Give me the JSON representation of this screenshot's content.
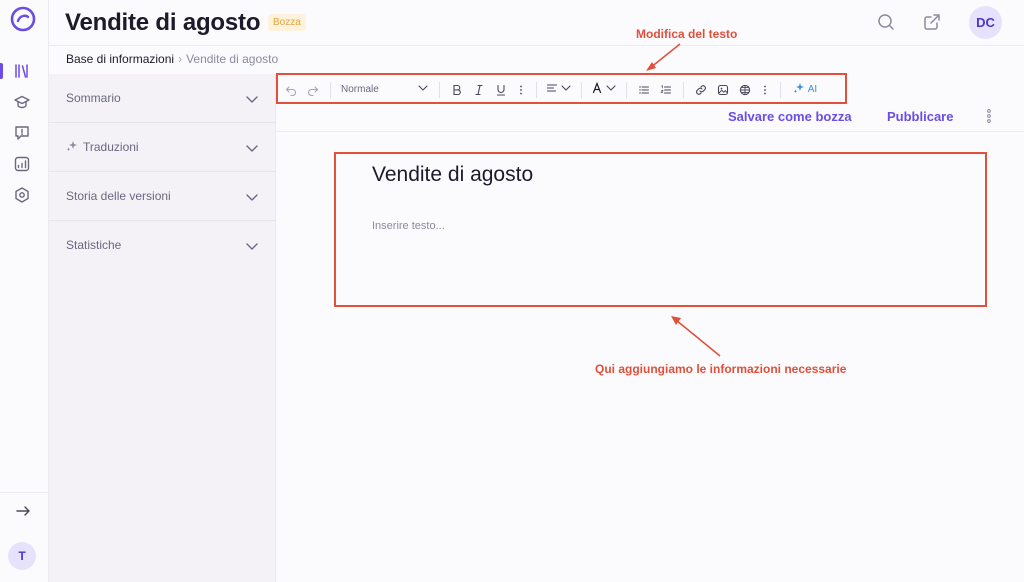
{
  "header": {
    "title": "Vendite di agosto",
    "status": "Bozza",
    "avatar_initials": "DC"
  },
  "breadcrumb": {
    "root": "Base di informazioni",
    "current": "Vendite di agosto"
  },
  "rail": {
    "items": [
      "library-icon",
      "graduation-cap-icon",
      "message-alert-icon",
      "analytics-icon",
      "settings-hexagon-icon"
    ],
    "user_initial": "T"
  },
  "sidebar": {
    "items": [
      {
        "label": "Sommario"
      },
      {
        "label": "Traduzioni"
      },
      {
        "label": "Storia delle versioni"
      },
      {
        "label": "Statistiche"
      }
    ]
  },
  "toolbar": {
    "format_value": "Normale",
    "ai_label": "AI"
  },
  "actions": {
    "save_draft": "Salvare come bozza",
    "publish": "Pubblicare"
  },
  "editor": {
    "title": "Vendite di agosto",
    "placeholder": "Inserire testo..."
  },
  "annotations": {
    "toolbar_note": "Modifica del testo",
    "editor_note": "Qui aggiungiamo le informazioni necessarie"
  },
  "colors": {
    "accent": "#6b4de6",
    "annotation": "#e0503a",
    "badge_bg": "#fdf2dc",
    "badge_text": "#e3a43a"
  }
}
